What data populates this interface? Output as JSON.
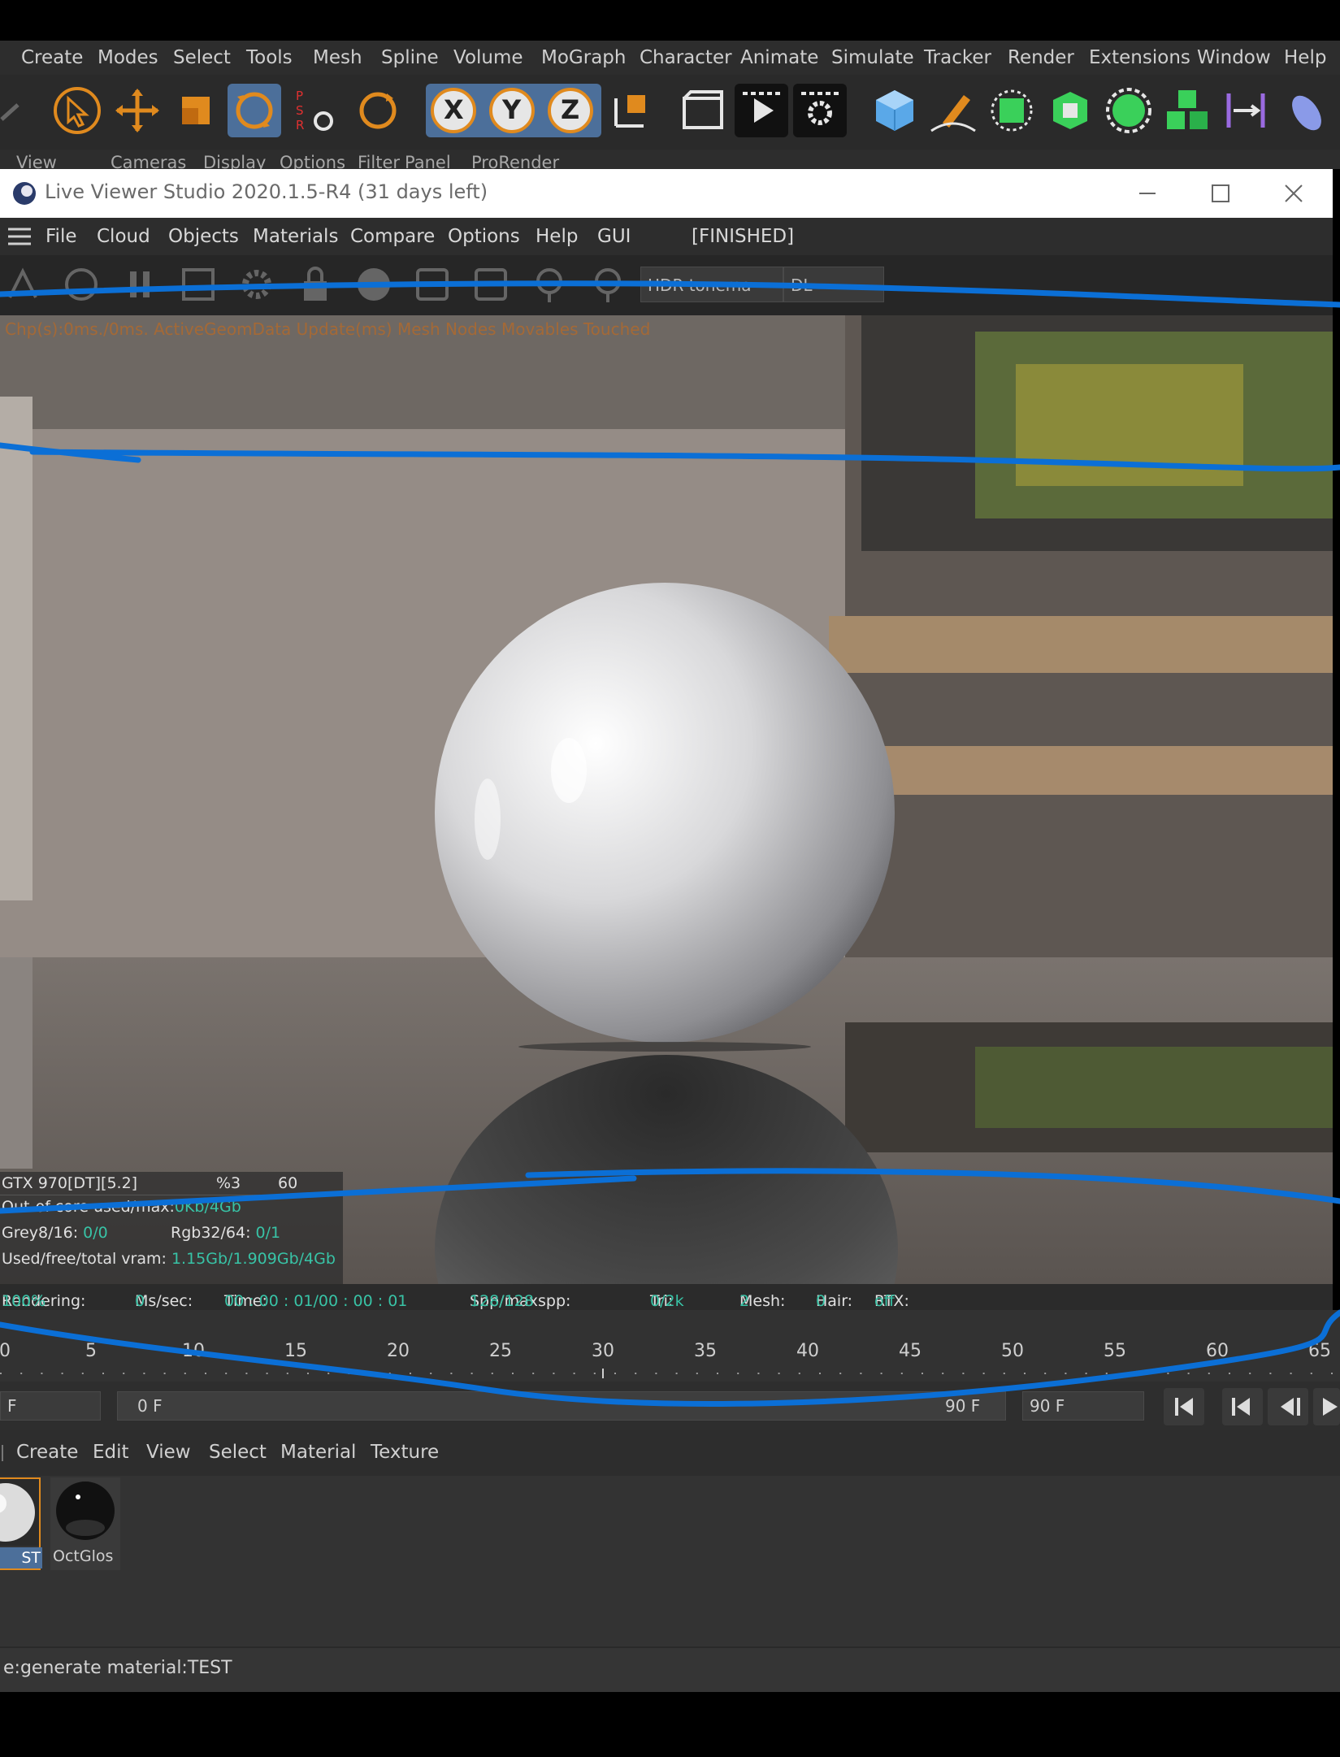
{
  "c4d_menu": [
    "Create",
    "Modes",
    "Select",
    "Tools",
    "Mesh",
    "Spline",
    "Volume",
    "MoGraph",
    "Character",
    "Animate",
    "Simulate",
    "Tracker",
    "Render",
    "Extensions",
    "Window",
    "Help"
  ],
  "c4d_toolbar": {
    "psr_letters": [
      "P",
      "S",
      "R"
    ],
    "axis_letters": [
      "X",
      "Y",
      "Z"
    ]
  },
  "c4d_view_menu": [
    "View",
    "Cameras",
    "Display",
    "Options",
    "Filter",
    "Panel",
    "ProRender"
  ],
  "live_viewer": {
    "title": "Live Viewer Studio 2020.1.5-R4 (31 days left)",
    "menu": [
      "File",
      "Cloud",
      "Objects",
      "Materials",
      "Compare",
      "Options",
      "Help",
      "GUI"
    ],
    "state": "[FINISHED]",
    "toolbar": {
      "tonemap_select": "HDR tonema",
      "kernel_select": "DL"
    },
    "counters_text": "Chp(s):0ms./0ms.  ActiveGeomData  Update(ms)  Mesh  Nodes  Movables  Touched"
  },
  "render_stats": {
    "gpu_name": "GTX 970[DT][5.2]",
    "gpu_pct": "%3",
    "gpu_temp": "60",
    "out_of_core_label": "Out-of-core used/max:",
    "out_of_core_value": "0Kb/4Gb",
    "grey_label": "Grey8/16:",
    "grey_value": "0/0",
    "rgb_label": "Rgb32/64:",
    "rgb_value": "0/1",
    "vram_label": "Used/free/total vram:",
    "vram_value": "1.15Gb/1.909Gb/4Gb"
  },
  "render_status": {
    "rendering_label": "Rendering:",
    "rendering_value": "100%",
    "mssec_label": "Ms/sec:",
    "mssec_value": "0",
    "time_label": "Time:",
    "time_value": "00 : 00 : 01/00 : 00 : 01",
    "spp_label": "Spp/maxspp:",
    "spp_value": "128/128",
    "tri_label": "Tri:",
    "tri_value": "0/2k",
    "mesh_label": "Mesh:",
    "mesh_value": "2",
    "hair_label": "Hair:",
    "hair_value": "0",
    "rtx_label": "RTX:",
    "rtx_value": "off"
  },
  "timeline": {
    "ticks": [
      "0",
      "5",
      "10",
      "15",
      "20",
      "25",
      "30",
      "35",
      "40",
      "45",
      "50",
      "55",
      "60",
      "65"
    ],
    "start_field": "F",
    "current_field": "0 F",
    "end_inner": "90 F",
    "end_field": "90 F"
  },
  "material_manager": {
    "menu": [
      "Create",
      "Edit",
      "View",
      "Select",
      "Material",
      "Texture"
    ],
    "materials": [
      {
        "name": "ST",
        "selected": true
      },
      {
        "name": "OctGlos",
        "selected": false
      }
    ]
  },
  "status_bar": "e:generate material:TEST",
  "colors": {
    "value_teal": "#38c3a6",
    "accent_orange": "#e08a1e",
    "selection_blue": "#4c6f9a",
    "annotation_blue": "#0b6fd6"
  }
}
